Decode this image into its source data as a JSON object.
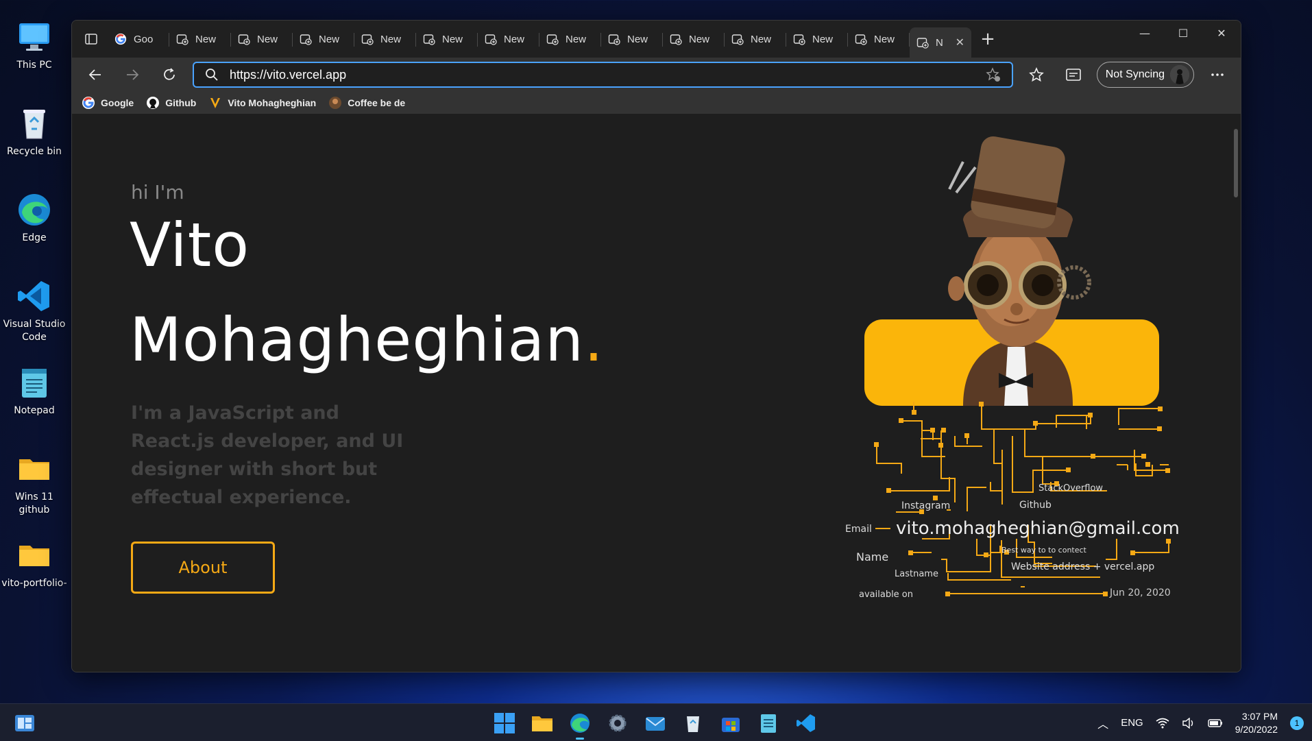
{
  "desktop": {
    "icons": [
      {
        "label": "This PC",
        "icon": "monitor-icon"
      },
      {
        "label": "Recycle bin",
        "icon": "recycle-bin-icon"
      },
      {
        "label": "Edge",
        "icon": "edge-icon"
      },
      {
        "label": "Visual Studio Code",
        "icon": "vscode-icon"
      },
      {
        "label": "Notepad",
        "icon": "notepad-icon"
      },
      {
        "label": "Wins 11 github",
        "icon": "folder-icon"
      },
      {
        "label": "vito-portfolio-",
        "icon": "folder-icon"
      }
    ]
  },
  "browser": {
    "tabs": [
      {
        "label": "Goo",
        "icon": "google-icon"
      },
      {
        "label": "New",
        "icon": "new-tab-icon"
      },
      {
        "label": "New",
        "icon": "new-tab-icon"
      },
      {
        "label": "New",
        "icon": "new-tab-icon"
      },
      {
        "label": "New",
        "icon": "new-tab-icon"
      },
      {
        "label": "New",
        "icon": "new-tab-icon"
      },
      {
        "label": "New",
        "icon": "new-tab-icon"
      },
      {
        "label": "New",
        "icon": "new-tab-icon"
      },
      {
        "label": "New",
        "icon": "new-tab-icon"
      },
      {
        "label": "New",
        "icon": "new-tab-icon"
      },
      {
        "label": "New",
        "icon": "new-tab-icon"
      },
      {
        "label": "New",
        "icon": "new-tab-icon"
      },
      {
        "label": "New",
        "icon": "new-tab-icon"
      },
      {
        "label": "N",
        "icon": "new-tab-icon",
        "active": true
      }
    ],
    "url": "https://vito.vercel.app",
    "sync_label": "Not Syncing",
    "favorites": [
      {
        "label": "Google",
        "icon": "google-icon"
      },
      {
        "label": "Github",
        "icon": "github-icon"
      },
      {
        "label": "Vito Mohagheghian",
        "icon": "vito-logo-icon"
      },
      {
        "label": "Coffee be de",
        "icon": "coffee-avatar-icon"
      }
    ]
  },
  "page": {
    "greeting": "hi I'm",
    "first_name": "Vito",
    "last_name": "Mohagheghian",
    "name_dot": ".",
    "bio": "I'm a JavaScript and React.js developer, and UI designer with short but effectual experience.",
    "about_button": "About",
    "accent": "#f5a915",
    "circuit": {
      "stackoverflow": "StackOverflow",
      "instagram": "Instagram",
      "github": "Github",
      "email_label": "Email",
      "email": "vito.mohagheghian@gmail.com",
      "name_label": "Name",
      "best_way": "Best way to to contect",
      "website": "Website address + vercel.app",
      "lastname": "Lastname",
      "available_on": "available on",
      "date": "Jun 20, 2020"
    }
  },
  "taskbar": {
    "lang": "ENG",
    "time": "3:07 PM",
    "date": "9/20/2022",
    "notifications": "1"
  }
}
